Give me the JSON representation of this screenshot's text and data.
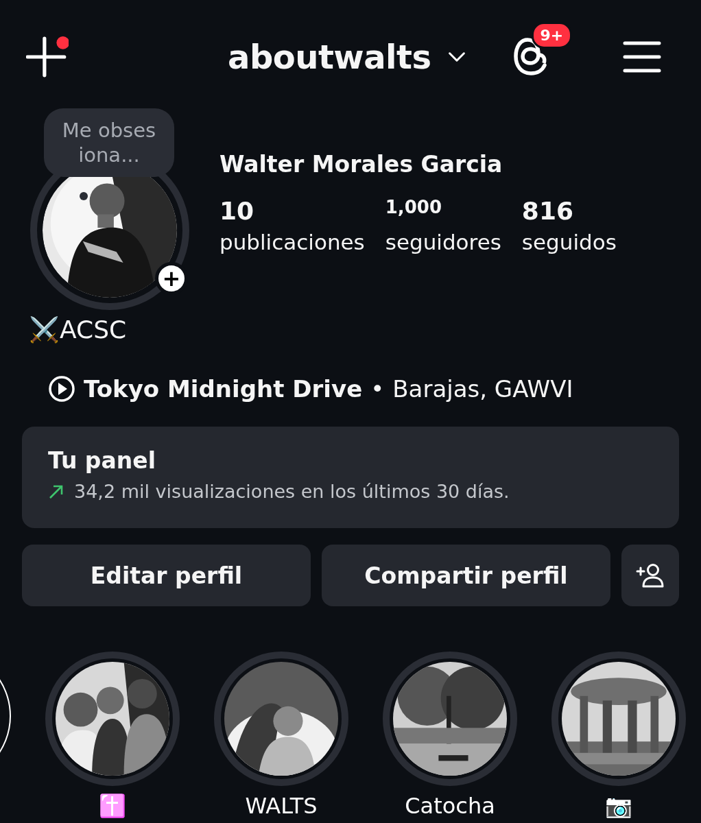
{
  "top_bar": {
    "new_post_dot": true,
    "username": "aboutwalts",
    "threads_badge": "9+"
  },
  "note": {
    "text": "Me obsesiona..."
  },
  "profile": {
    "add_story": "+",
    "name": "Walter Morales Garcia",
    "stats": [
      {
        "number": "10",
        "label": "publicaciones"
      },
      {
        "number": "1,000",
        "label": "seguidores"
      },
      {
        "number": "816",
        "label": "seguidos"
      }
    ],
    "bio_name": "⚔️ACSC",
    "music": {
      "track": "Tokyo Midnight Drive",
      "separator": "•",
      "artist": "Barajas, GAWVI"
    }
  },
  "panel": {
    "title": "Tu panel",
    "stat": "34,2 mil visualizaciones en los últimos 30 días."
  },
  "buttons": [
    "Editar perfil",
    "Compartir perfil"
  ],
  "highlights": [
    {
      "label": "✝️",
      "kind": "picture"
    },
    {
      "label": "WALTS",
      "kind": "picture"
    },
    {
      "label": "Catocha",
      "kind": "picture"
    },
    {
      "label": "📷",
      "kind": "picture"
    }
  ]
}
